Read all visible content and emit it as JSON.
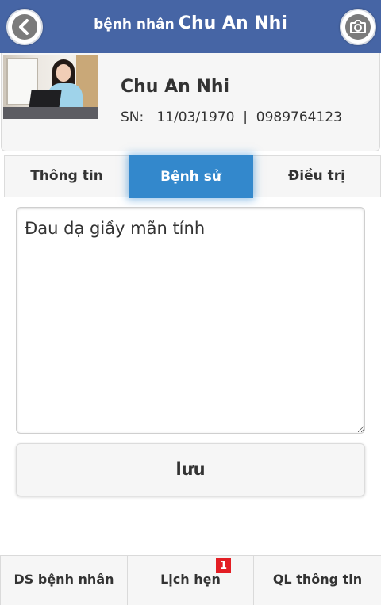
{
  "header": {
    "title_prefix": "bệnh nhân",
    "title_name": "Chu An Nhi",
    "back_icon": "back-arrow-icon",
    "camera_icon": "camera-icon",
    "background_color": "#4665a5"
  },
  "patient": {
    "name": "Chu An Nhi",
    "info_line": "SN:   11/03/1970  |  0989764123"
  },
  "tabs": [
    {
      "label": "Thông tin",
      "active": false
    },
    {
      "label": "Bệnh sử",
      "active": true
    },
    {
      "label": "Điều trị",
      "active": false
    }
  ],
  "history": {
    "value": "Đau dạ giầy mãn tính"
  },
  "save_button": {
    "label": "lưu"
  },
  "footer": {
    "items": [
      {
        "label": "DS bệnh nhân"
      },
      {
        "label": "Lịch hẹn",
        "badge": "1"
      },
      {
        "label": "QL thông tin"
      }
    ]
  },
  "colors": {
    "accent": "#3388cc",
    "badge": "#e31e24"
  }
}
